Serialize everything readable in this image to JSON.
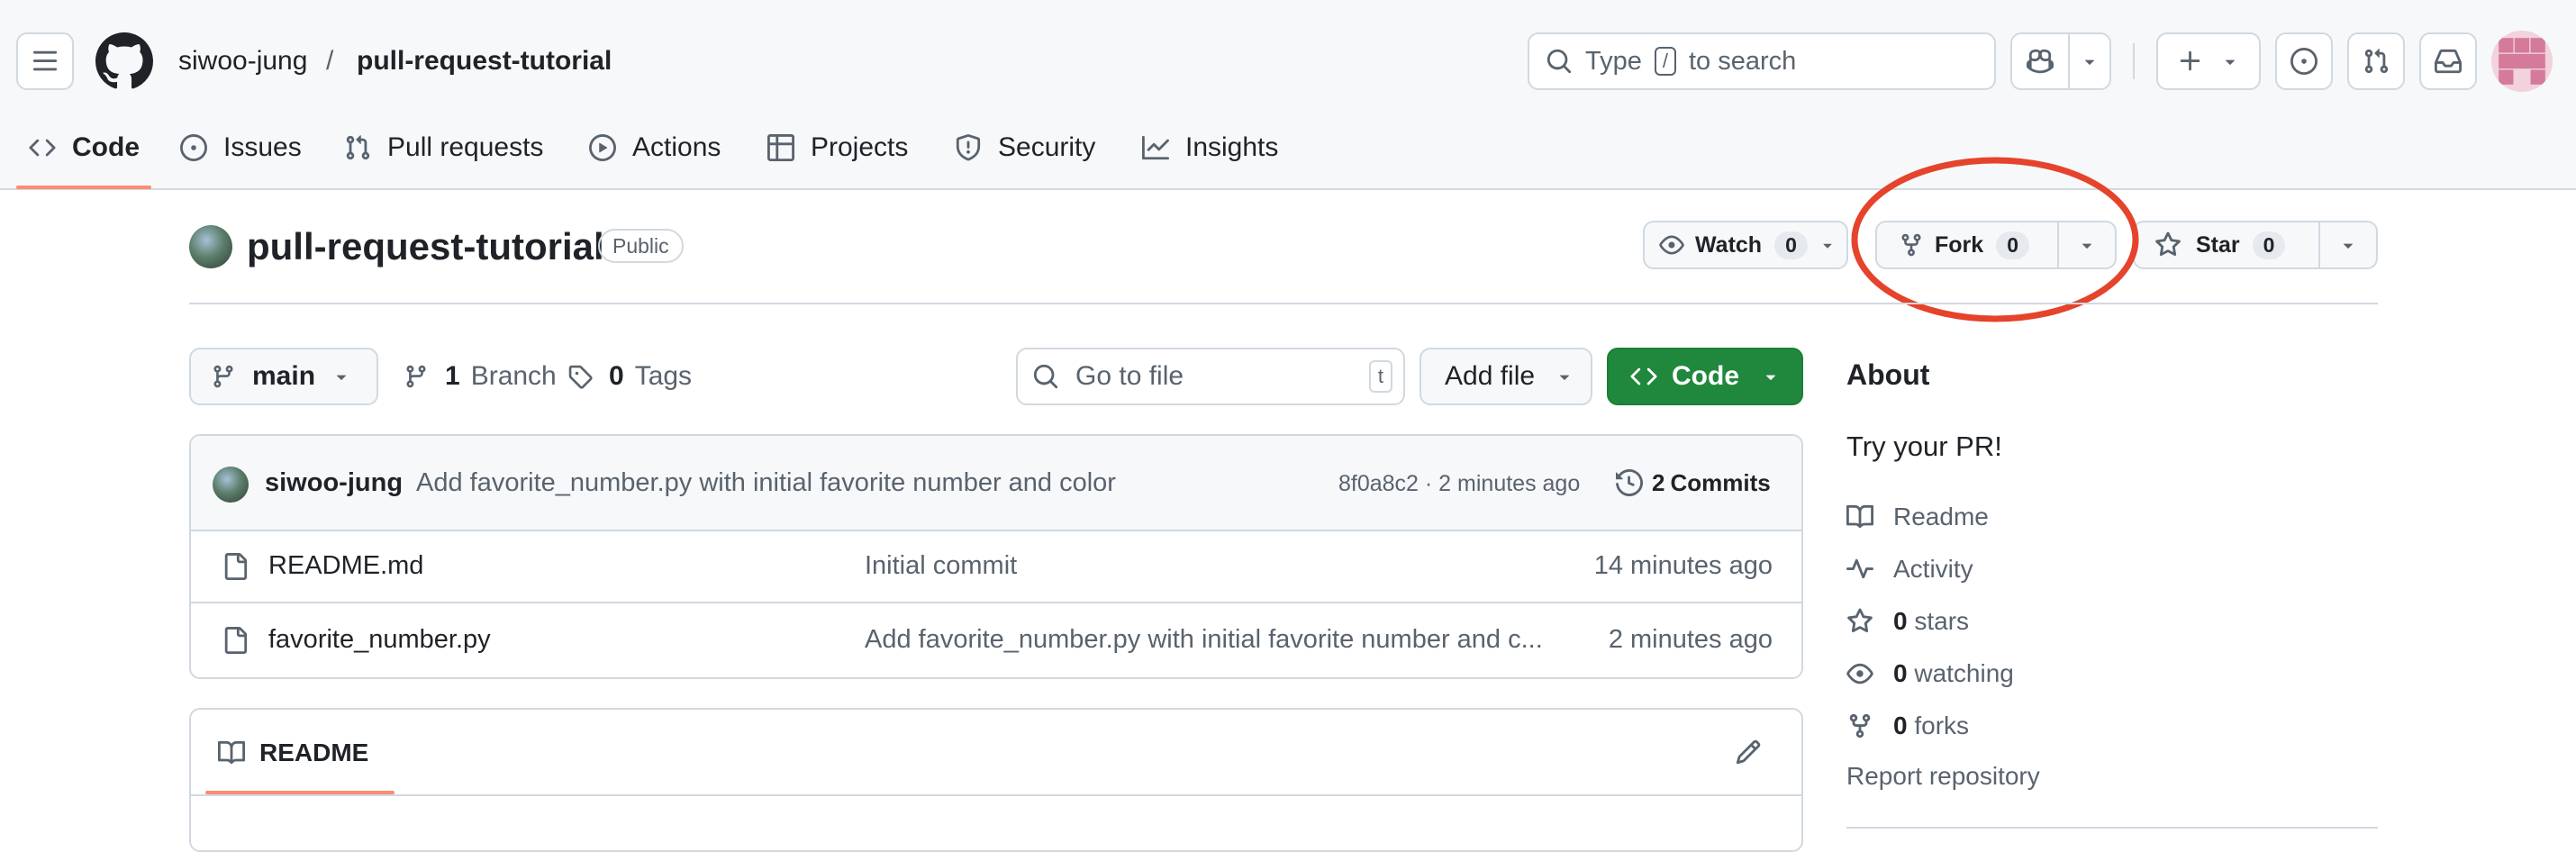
{
  "header": {
    "owner": "siwoo-jung",
    "separator": "/",
    "repo": "pull-request-tutorial",
    "search_prefix": "Type",
    "search_key": "/",
    "search_suffix": "to search"
  },
  "tabs": [
    {
      "label": "Code",
      "active": true
    },
    {
      "label": "Issues"
    },
    {
      "label": "Pull requests"
    },
    {
      "label": "Actions"
    },
    {
      "label": "Projects"
    },
    {
      "label": "Security"
    },
    {
      "label": "Insights"
    }
  ],
  "repo_header": {
    "title": "pull-request-tutorial",
    "visibility": "Public",
    "watch_label": "Watch",
    "watch_count": "0",
    "fork_label": "Fork",
    "fork_count": "0",
    "star_label": "Star",
    "star_count": "0"
  },
  "controls": {
    "branch": "main",
    "branch_count": "1",
    "branch_label": "Branch",
    "tag_count": "0",
    "tag_label": "Tags",
    "goto_placeholder": "Go to file",
    "goto_key": "t",
    "add_file": "Add file",
    "code": "Code"
  },
  "commit": {
    "author": "siwoo-jung",
    "message": "Add favorite_number.py with initial favorite number and color",
    "sha_time": "8f0a8c2 · 2 minutes ago",
    "commits_count": "2",
    "commits_label": "Commits"
  },
  "files": [
    {
      "name": "README.md",
      "message": "Initial commit",
      "age": "14 minutes ago"
    },
    {
      "name": "favorite_number.py",
      "message": "Add favorite_number.py with initial favorite number and c...",
      "age": "2 minutes ago"
    }
  ],
  "readme": {
    "title": "README"
  },
  "about": {
    "heading": "About",
    "description": "Try your PR!",
    "readme": "Readme",
    "activity": "Activity",
    "stars_count": "0",
    "stars_label": "stars",
    "watching_count": "0",
    "watching_label": "watching",
    "forks_count": "0",
    "forks_label": "forks",
    "report": "Report repository"
  },
  "colors": {
    "accent_underline": "#fd8c73",
    "code_button": "#1f883d",
    "annotation_circle": "#e5432b"
  }
}
